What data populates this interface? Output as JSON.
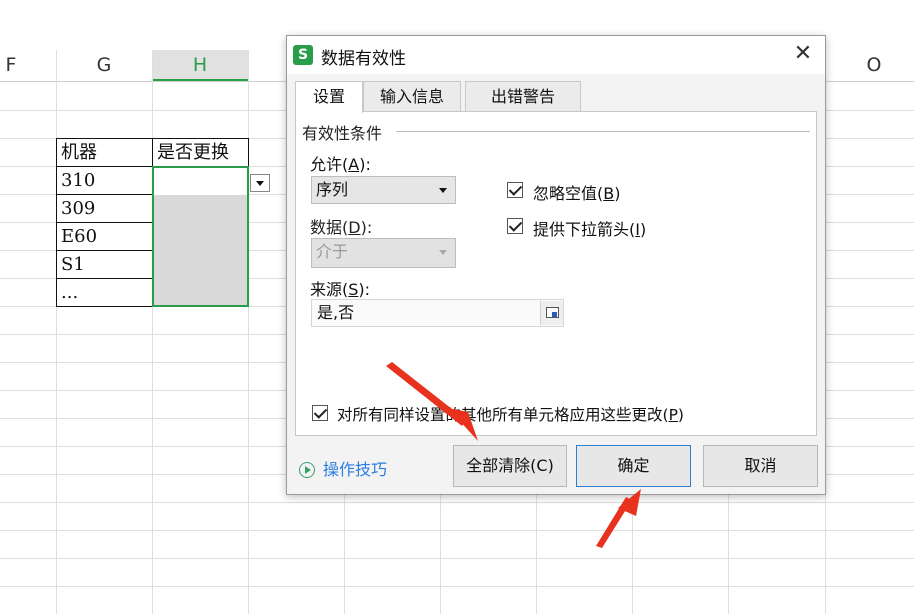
{
  "sheet": {
    "columns": [
      "F",
      "G",
      "H",
      "O"
    ],
    "selected_column": "H",
    "table": {
      "headers": [
        "机器",
        "是否更换"
      ],
      "rows": [
        "310",
        "309",
        "E60",
        "S1",
        "..."
      ]
    }
  },
  "dialog": {
    "title": "数据有效性",
    "app_icon": "S",
    "close_glyph": "✕",
    "tabs": [
      "设置",
      "输入信息",
      "出错警告"
    ],
    "group_title": "有效性条件",
    "allow": {
      "label_prefix": "允许(",
      "label_key": "A",
      "label_suffix": "):",
      "value": "序列"
    },
    "data": {
      "label_prefix": "数据(",
      "label_key": "D",
      "label_suffix": "):",
      "value": "介于"
    },
    "ignore_blank": {
      "label_prefix": "忽略空值(",
      "label_key": "B",
      "label_suffix": ")",
      "checked": true
    },
    "dropdown_arrow": {
      "label_prefix": "提供下拉箭头(",
      "label_key": "I",
      "label_suffix": ")",
      "checked": true
    },
    "source": {
      "label_prefix": "来源(",
      "label_key": "S",
      "label_suffix": "):",
      "value": "是,否"
    },
    "apply_all": {
      "label_prefix": "对所有同样设置的其他所有单元格应用这些更改(",
      "label_key": "P",
      "label_suffix": ")",
      "checked": true
    },
    "tips_link": "操作技巧",
    "buttons": {
      "clear_all": "全部清除(C)",
      "ok": "确定",
      "cancel": "取消"
    }
  },
  "colors": {
    "accent_blue": "#2f7fcf",
    "selection_green": "#2a9d4a",
    "arrow_red": "#e8321e"
  }
}
